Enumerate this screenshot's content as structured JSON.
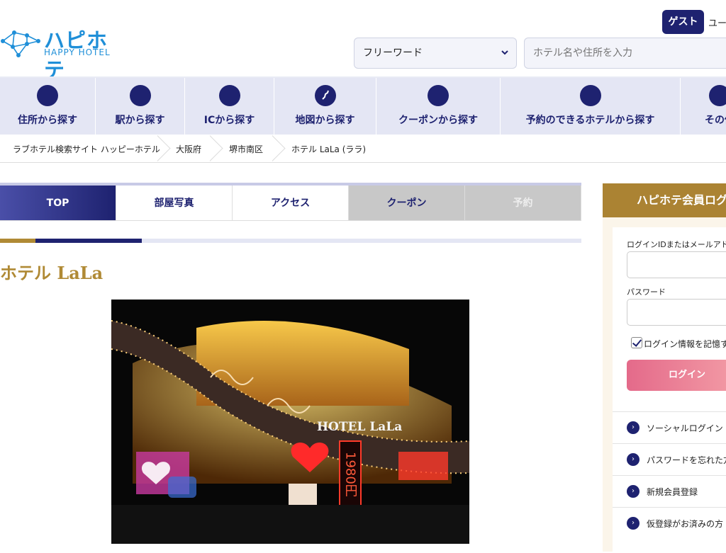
{
  "header": {
    "logo_text": "ハピホテ",
    "logo_sub": "HAPPY HOTEL",
    "guest_label": "ゲスト",
    "user_label": "ユー",
    "search": {
      "select_value": "フリーワード",
      "input_placeholder": "ホテル名や住所を入力"
    }
  },
  "nav": {
    "items": [
      {
        "label": "住所から探す",
        "icon": "location-icon"
      },
      {
        "label": "駅から探す",
        "icon": "train-icon"
      },
      {
        "label": "ICから探す",
        "icon": "highway-icon"
      },
      {
        "label": "地図から探す",
        "icon": "map-icon"
      },
      {
        "label": "クーポンから探す",
        "icon": "coupon-icon"
      },
      {
        "label": "予約のできるホテルから探す",
        "icon": "calendar-icon"
      },
      {
        "label": "その他",
        "icon": "more-icon"
      }
    ]
  },
  "breadcrumb": [
    "ラブホテル検索サイト ハッピーホテル",
    "大阪府",
    "堺市南区",
    "ホテル LaLa (ララ)"
  ],
  "tabs": [
    "TOP",
    "部屋写真",
    "アクセス",
    "クーポン",
    "予約"
  ],
  "hotel": {
    "title": "ホテル LaLa",
    "sign_text": "HOTEL LaLa",
    "price_sign": "1980円"
  },
  "sidebar": {
    "login_title": "ハピホテ会員ログ",
    "id_label": "ログインIDまたはメールアドレ",
    "password_label": "パスワード",
    "remember_label": "ログイン情報を記憶す",
    "login_button": "ログイン",
    "links": [
      "ソーシャルログイン",
      "パスワードを忘れた方",
      "新規会員登録",
      "仮登録がお済みの方"
    ]
  },
  "colors": {
    "navy": "#1e2270",
    "gold": "#ab8333",
    "nav_bg": "#e4e6f4",
    "logo_blue": "#1f8fd8"
  }
}
